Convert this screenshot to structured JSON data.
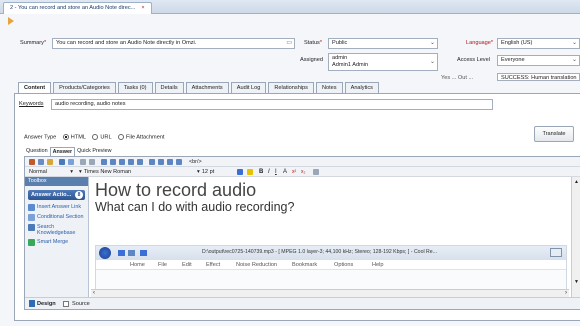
{
  "window": {
    "doc_tab_title": "2 - You can record and store an Audio Note direc...",
    "close_glyph": "×"
  },
  "form": {
    "summary_label": "Summary",
    "summary_value": "You can record and store an Audio Note directly in Omzi.",
    "status_label": "Status",
    "status_value": "Public",
    "language_label": "Language",
    "language_value": "English (US)",
    "assigned_label": "Assigned",
    "assigned_line1": "admin",
    "assigned_line2": "Admin1 Admin",
    "access_label": "Access Level",
    "access_value": "Everyone",
    "cut_label": "Yes ... Out ...",
    "cut_value": "SUCCESS: Human translation"
  },
  "tabs": [
    "Content",
    "Products/Categories",
    "Tasks (0)",
    "Details",
    "Attachments",
    "Audit Log",
    "Relationships",
    "Notes",
    "Analytics"
  ],
  "content": {
    "keywords_label": "Keywords",
    "keywords_value": "audio recording, audio notes",
    "translate_label": "Translate",
    "answer_type_label": "Answer Type",
    "opt_html": "HTML",
    "opt_url": "URL",
    "opt_file": "File Attachment"
  },
  "editor": {
    "tabs": [
      "Question",
      "Answer",
      "Quick Preview"
    ],
    "style_value": "Normal",
    "font_value": "Times New Roman",
    "size_value": "12 pt",
    "br_tag": "<br/>",
    "toolbox_label": "Toolbox",
    "toolbox_header": "Answer Actio...",
    "toolbox_count": "8",
    "toolbox_items": [
      "Insert Answer Link",
      "Conditional Section",
      "Search Knowledgebase",
      "Smart Merge"
    ],
    "heading": "How to record audio",
    "subheading": "What can I do with audio recording?",
    "shot_path": "D:\\output\\rec0725-140739.mp3 - [ MPEG 1.0 layer-3; 44,100 kHz; Stereo; 128-192 Kbps; ] - Cool Re...",
    "shot_ribbon": [
      "Home",
      "File",
      "Edit",
      "Effect",
      "Noise Reduction",
      "Bookmark",
      "Options",
      "Help"
    ],
    "mode_design": "Design",
    "mode_source": "Source"
  },
  "colors": {
    "accent_blue": "#2d5593",
    "required_red": "#b01515"
  }
}
